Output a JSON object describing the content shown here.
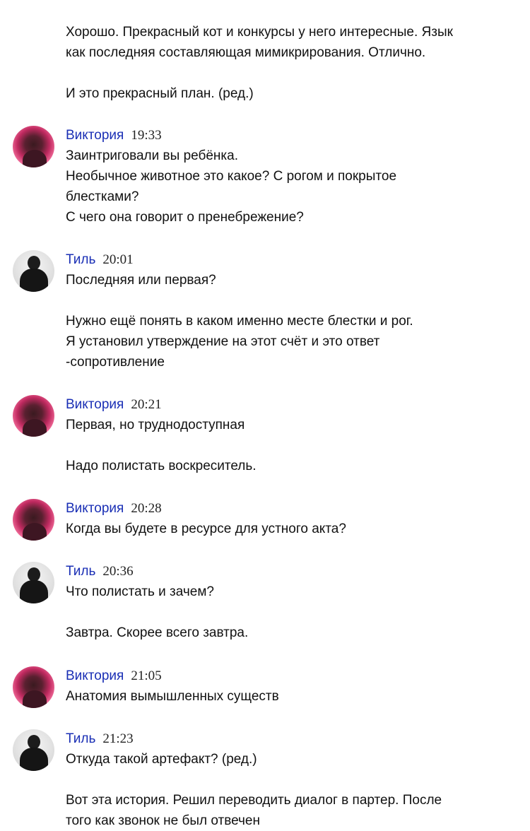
{
  "messages": [
    {
      "author": "",
      "time": "",
      "text": "Хорошо. Прекрасный кот и конкурсы у него интересные. Язык\nкак последняя составляющая мимикрирования. Отлично.\n\nИ это прекрасный план. (ред.)"
    },
    {
      "author": "Виктория",
      "time": "19:33",
      "avatar": "viktoria-avatar",
      "text": "Заинтриговали вы ребёнка.\nНеобычное животное это какое? С рогом и покрытое\nблестками?\nС чего она говорит о пренебрежение?"
    },
    {
      "author": "Тиль",
      "time": "20:01",
      "avatar": "til-avatar",
      "text": "Последняя или первая?\n\nНужно ещё понять в каком именно месте блестки и рог.\nЯ установил утверждение на этот счёт и это ответ\n-сопротивление"
    },
    {
      "author": "Виктория",
      "time": "20:21",
      "avatar": "viktoria-avatar",
      "text": "Первая, но труднодоступная\n\nНадо полистать воскреситель."
    },
    {
      "author": "Виктория",
      "time": "20:28",
      "avatar": "viktoria-avatar",
      "text": "Когда вы будете в ресурсе для устного акта?"
    },
    {
      "author": "Тиль",
      "time": "20:36",
      "avatar": "til-avatar",
      "text": "Что полистать и зачем?\n\nЗавтра. Скорее всего завтра."
    },
    {
      "author": "Виктория",
      "time": "21:05",
      "avatar": "viktoria-avatar",
      "text": "Анатомия вымышленных существ"
    },
    {
      "author": "Тиль",
      "time": "21:23",
      "avatar": "til-avatar",
      "text": "Откуда такой артефакт? (ред.)\n\nВот эта история. Решил переводить диалог в партер. После\nтого как звонок не был отвечен"
    }
  ]
}
